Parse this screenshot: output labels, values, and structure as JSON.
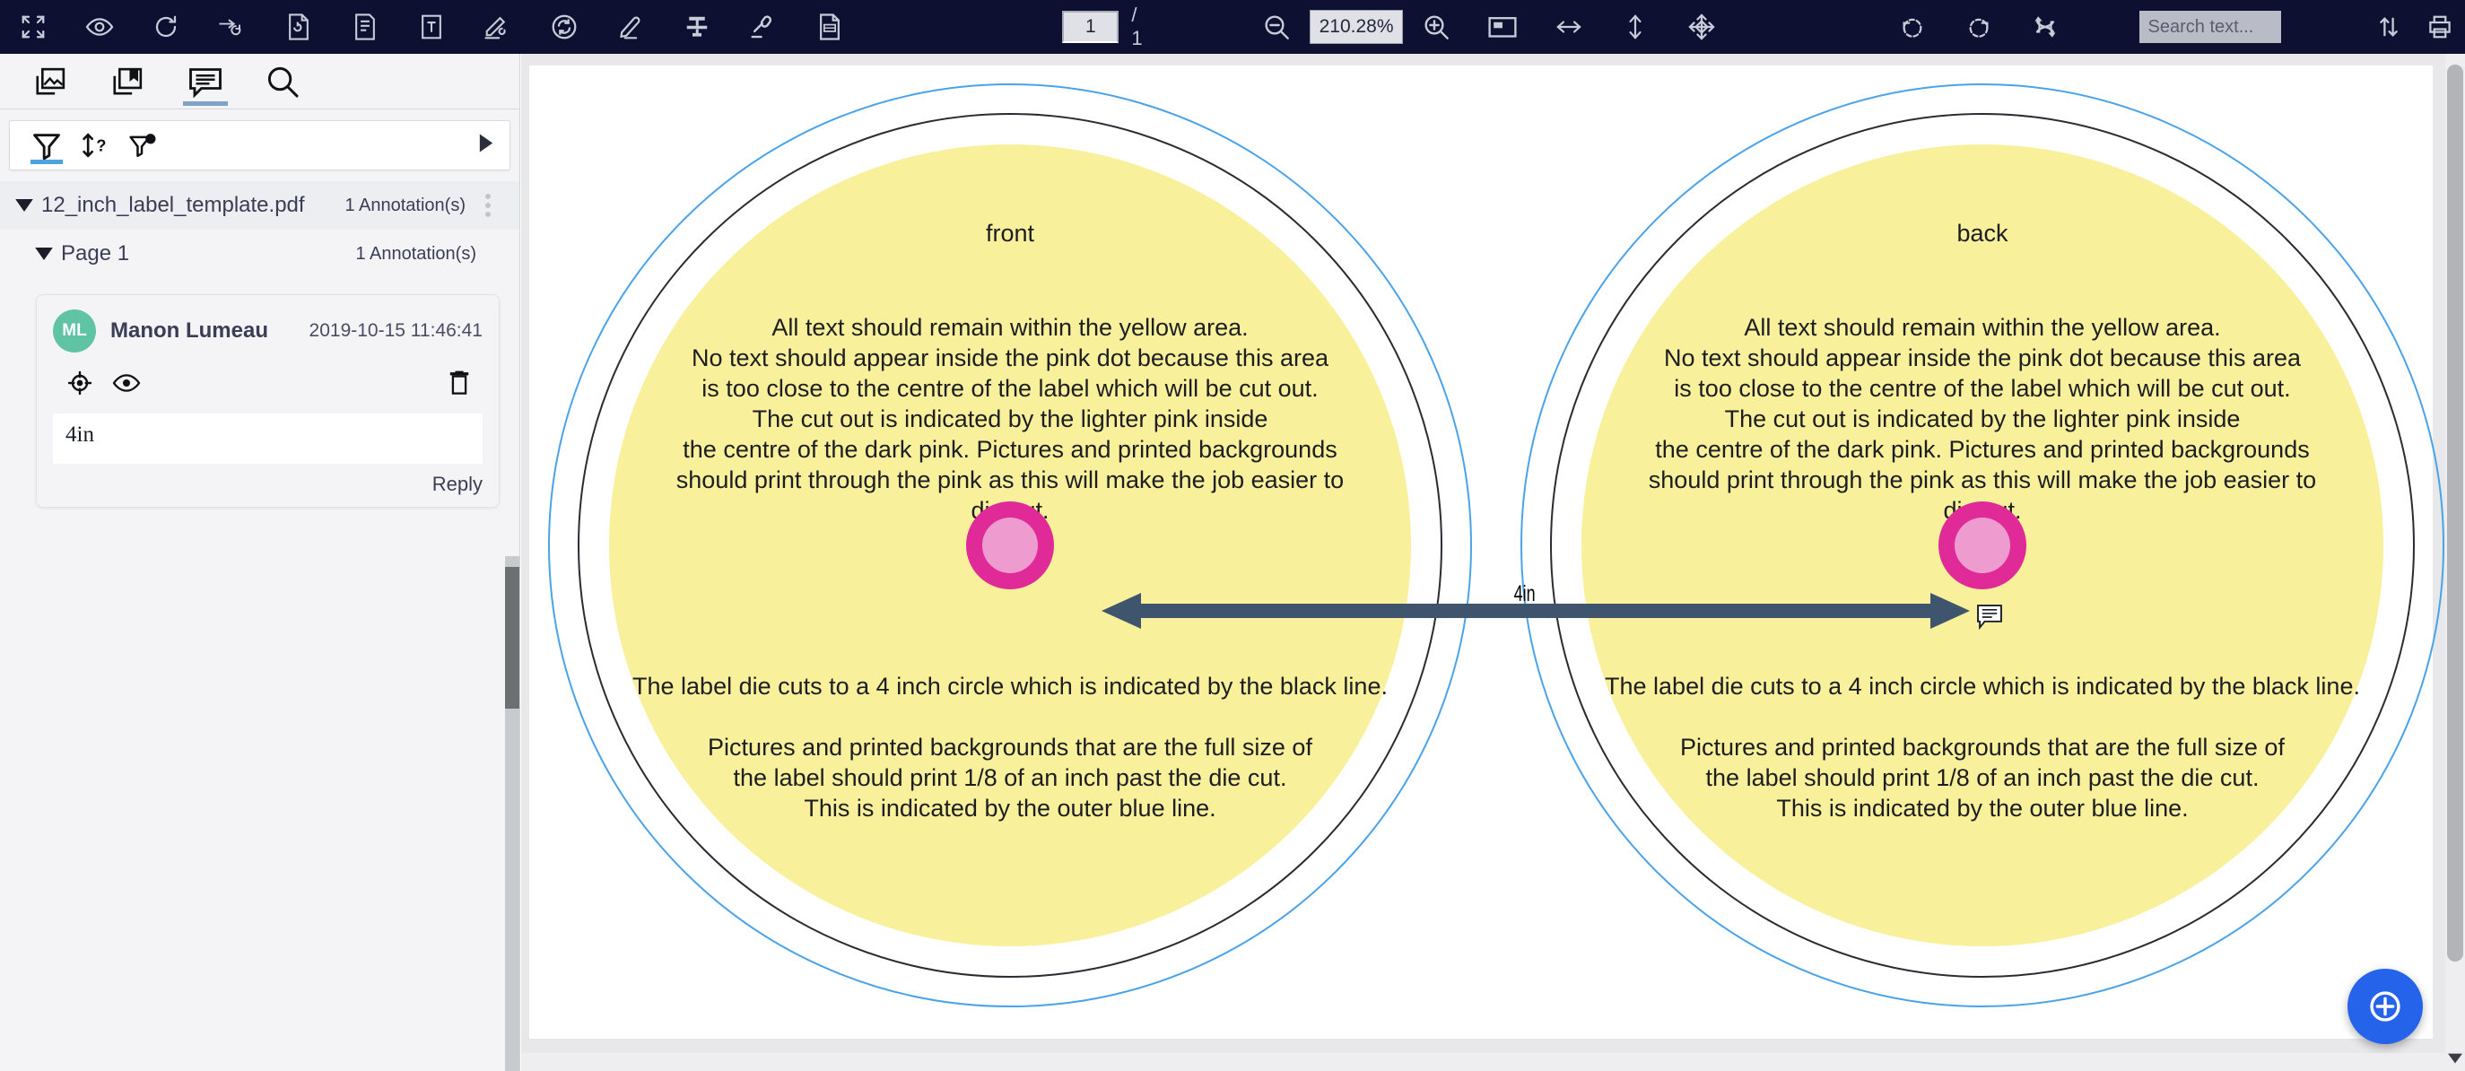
{
  "toolbar": {
    "left_tools": [
      {
        "name": "fullscreen-icon",
        "label": "Fullscreen"
      },
      {
        "name": "eye-icon",
        "label": "Visibility"
      },
      {
        "name": "refresh-icon",
        "label": "Reload"
      },
      {
        "name": "sync-arrows-icon",
        "label": "Sync"
      },
      {
        "name": "form-field-icon",
        "label": "Form field"
      },
      {
        "name": "text-note-icon",
        "label": "Note"
      },
      {
        "name": "text-box-icon",
        "label": "Text box"
      },
      {
        "name": "signature-icon",
        "label": "Signature"
      },
      {
        "name": "refresh-circle-icon",
        "label": "Refresh"
      },
      {
        "name": "highlighter-icon",
        "label": "Highlighter"
      },
      {
        "name": "strikeout-icon",
        "label": "Strikeout"
      },
      {
        "name": "stamp-icon",
        "label": "Stamp"
      },
      {
        "name": "redact-document-icon",
        "label": "Redact"
      }
    ],
    "page_value": "1",
    "page_total": "/ 1",
    "zoom_out_icon": "zoom-out-icon",
    "zoom_value": "210.28%",
    "zoom_in_icon": "zoom-in-icon",
    "fit_page_icon": "fit-page-icon",
    "fit_width_icon": "fit-width-icon",
    "fit_height_icon": "fit-height-icon",
    "pan_icon": "pan-icon",
    "rotate_ccw_icon": "rotate-counterclockwise-icon",
    "rotate_cw_icon": "rotate-clockwise-icon",
    "shuffle_icon": "shuffle-pages-icon",
    "search_placeholder": "Search text...",
    "search_value": "",
    "sort_icon": "sort-updown-icon",
    "print_icon": "print-icon"
  },
  "sidebar": {
    "tabs": [
      {
        "name": "tab-thumbnails",
        "icon": "thumbnails-icon",
        "active": false
      },
      {
        "name": "tab-outline",
        "icon": "bookmark-icon",
        "active": false
      },
      {
        "name": "tab-annotations",
        "icon": "annotations-icon",
        "active": true
      },
      {
        "name": "tab-search",
        "icon": "search-icon",
        "active": false
      }
    ],
    "filter_bar": {
      "filter_icon": "filter-icon",
      "sort_icon": "sort-unknown-icon",
      "filter_author_icon": "filter-by-author-icon",
      "expand_icon": "expand-right-icon"
    },
    "tree": {
      "file_name": "12_inch_label_template.pdf",
      "file_count": "1 Annotation(s)",
      "page_name": "Page 1",
      "page_count": "1 Annotation(s)"
    },
    "annotation": {
      "avatar_initials": "ML",
      "author": "Manon Lumeau",
      "timestamp": "2019-10-15 11:46:41",
      "goto_icon": "target-crosshair-icon",
      "visibility_icon": "eye-icon",
      "delete_icon": "trash-icon",
      "text": "4in",
      "reply_label": "Reply"
    }
  },
  "document": {
    "labels": [
      {
        "side": "front",
        "top_text": "All text should remain within the yellow area.\nNo text should appear inside the pink dot because this area\nis too close to the centre of the label which will be cut out.\nThe cut out is indicated by the lighter pink inside\nthe centre of the dark pink. Pictures and printed backgrounds\nshould print through the pink as this will make the job easier to\ndie cut.",
        "bottom_text_1": "The label die cuts to a 4 inch circle which is indicated by the black line.",
        "bottom_text_2": "Pictures and printed backgrounds that are the full size of\nthe label should print 1/8 of an inch past the die cut.\nThis is indicated by the outer blue line."
      },
      {
        "side": "back",
        "top_text": "All text should remain within the yellow area.\nNo text should appear inside the pink dot because this area\nis too close to the centre of the label which will be cut out.\nThe cut out is indicated by the lighter pink inside\nthe centre of the dark pink. Pictures and printed backgrounds\nshould print through the pink as this will make the job easier to\ndie cut.",
        "bottom_text_1": "The label die cuts to a 4 inch circle which is indicated by the black line.",
        "bottom_text_2": "Pictures and printed backgrounds that are the full size of\nthe label should print 1/8 of an inch past the die cut.\nThis is indicated by the outer blue line."
      }
    ],
    "measurement_annotation": {
      "label": "4in",
      "icon": "comment-note-icon"
    },
    "add_annotation_button": {
      "icon": "plus-circle-icon"
    }
  },
  "colors": {
    "toolbar_bg": "#0d1030",
    "accent_blue": "#2563eb",
    "tab_underline": "#7da3c9",
    "filter_underline": "#4da3e0",
    "avatar_bg": "#60c3a4",
    "label_yellow": "#f8f09a",
    "label_blue_line": "#4aa3e8",
    "label_black_line": "#2b2b33",
    "dot_dark_pink": "#e02a98",
    "dot_light_pink": "#ee9cd0",
    "arrow_color": "#3f556e"
  }
}
